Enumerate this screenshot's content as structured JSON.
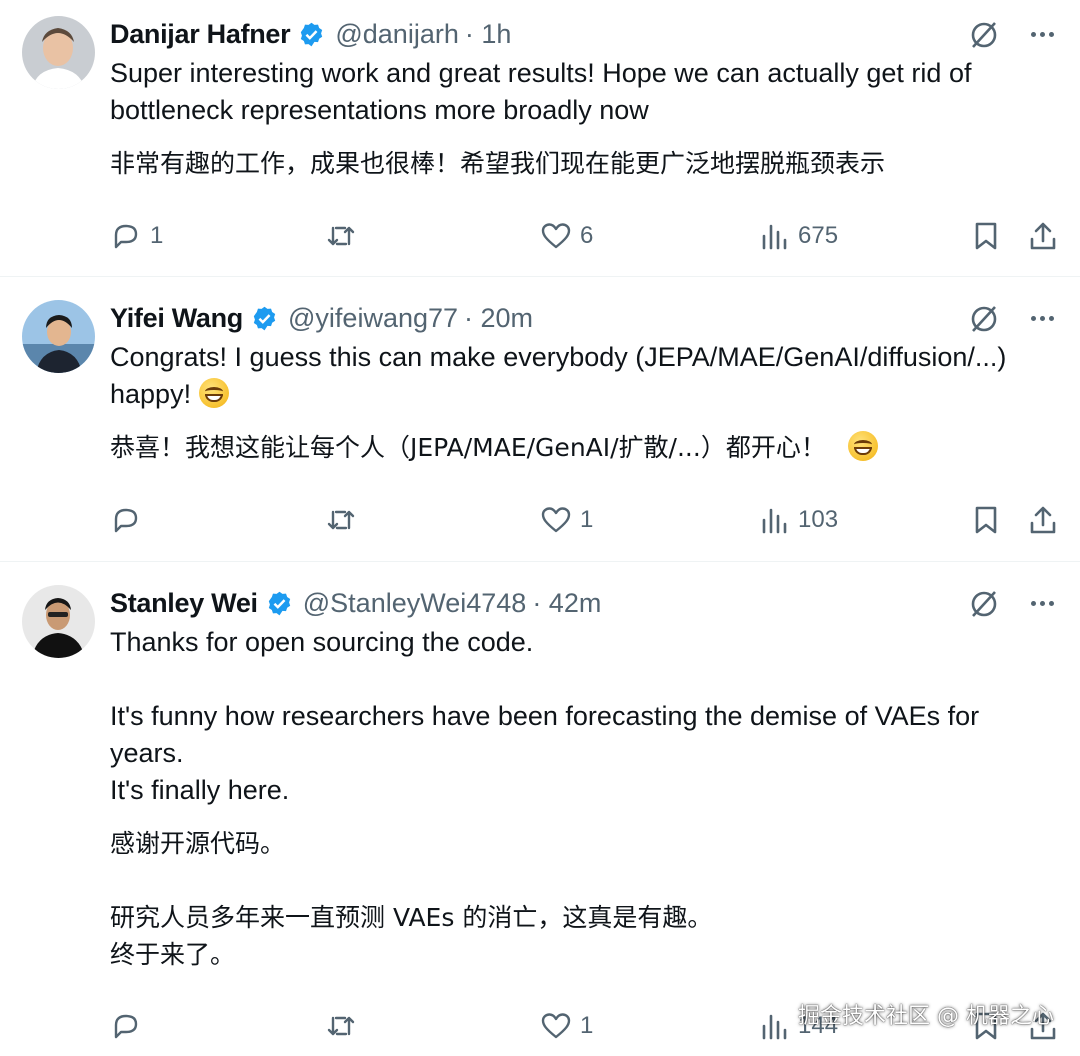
{
  "tweets": [
    {
      "name": "Danijar Hafner",
      "handle": "@danijarh",
      "time": "· 1h",
      "text_en": [
        "Super interesting work and great results! Hope we can actually get rid of bottleneck representations more broadly now"
      ],
      "text_zh": [
        "非常有趣的工作，成果也很棒！希望我们现在能更广泛地摆脱瓶颈表示"
      ],
      "replies": "1",
      "retweets": "",
      "likes": "6",
      "views": "675"
    },
    {
      "name": "Yifei Wang",
      "handle": "@yifeiwang77",
      "time": "· 20m",
      "text_en": [
        "Congrats! I guess this can make everybody (JEPA/MAE/GenAI/diffusion/...) happy!"
      ],
      "text_zh": [
        "恭喜！我想这能让每个人（JEPA/MAE/GenAI/扩散/...）都开心！"
      ],
      "replies": "",
      "retweets": "",
      "likes": "1",
      "views": "103"
    },
    {
      "name": "Stanley Wei",
      "handle": "@StanleyWei4748",
      "time": "· 42m",
      "text_en": [
        "Thanks for open sourcing the code.",
        "It's funny how researchers have been forecasting the demise of VAEs for years.",
        "It's finally here."
      ],
      "text_zh": [
        "感谢开源代码。",
        "研究人员多年来一直预测 VAEs 的消亡，这真是有趣。",
        "终于来了。"
      ],
      "replies": "",
      "retweets": "",
      "likes": "1",
      "views": "144"
    }
  ],
  "watermark": "掘金技术社区 @ 机器之心",
  "colors": {
    "verified": "#1d9bf0",
    "secondary": "#536471",
    "divider": "#eff3f4"
  },
  "icons": [
    "reply-icon",
    "retweet-icon",
    "like-icon",
    "views-icon",
    "bookmark-icon",
    "share-icon",
    "grok-icon",
    "more-icon",
    "verified-badge-icon"
  ]
}
